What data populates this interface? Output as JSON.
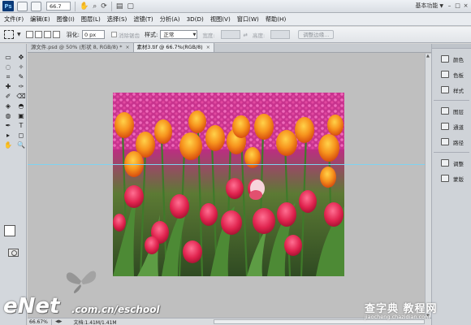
{
  "appbar": {
    "logo": "Ps",
    "zoom": "66.7",
    "workspace": "基本功能",
    "window_buttons": [
      "–",
      "□",
      "×"
    ]
  },
  "menu": [
    "文件(F)",
    "编辑(E)",
    "图像(I)",
    "图层(L)",
    "选择(S)",
    "滤镜(T)",
    "分析(A)",
    "3D(D)",
    "视图(V)",
    "窗口(W)",
    "帮助(H)"
  ],
  "options": {
    "feather_label": "羽化:",
    "feather_value": "0 px",
    "antialias_label": "消除锯齿",
    "style_label": "样式:",
    "style_value": "正常",
    "width_label": "宽度:",
    "height_label": "高度:",
    "refine_button": "调整边缘..."
  },
  "tabs": [
    {
      "label": "源文件.psd @ 50% (形状 8, RGB/8) *",
      "active": false
    },
    {
      "label": "素材3.tif @ 66.7%(RGB/8)",
      "active": true
    }
  ],
  "status": {
    "zoom": "66.67%",
    "doc": "文档:1.41M/1.41M"
  },
  "panels": [
    {
      "label": "颜色",
      "icon": "color-icon"
    },
    {
      "label": "色板",
      "icon": "swatches-icon"
    },
    {
      "label": "样式",
      "icon": "styles-icon"
    },
    {
      "label": "图层",
      "icon": "layers-icon"
    },
    {
      "label": "通道",
      "icon": "channels-icon"
    },
    {
      "label": "路径",
      "icon": "paths-icon"
    },
    {
      "label": "调整",
      "icon": "adjustments-icon"
    },
    {
      "label": "蒙版",
      "icon": "masks-icon"
    }
  ],
  "tools": [
    "▭",
    "✥",
    "◌",
    "✧",
    "⌗",
    "✎",
    "✚",
    "✑",
    "✐",
    "⌫",
    "◈",
    "◓",
    "◍",
    "▣",
    "✒",
    "T",
    "▸",
    "◻",
    "✋",
    "🔍"
  ],
  "watermarks": {
    "enet_logo": "eNet",
    "enet_site": ".com.cn/eschool",
    "cz_title": "查字典 教程网",
    "cz_url": "jiaocheng.chazidian.com"
  },
  "colors": {
    "guide": "#7fd3f0",
    "canvas_bg": "#bfbfbf"
  }
}
